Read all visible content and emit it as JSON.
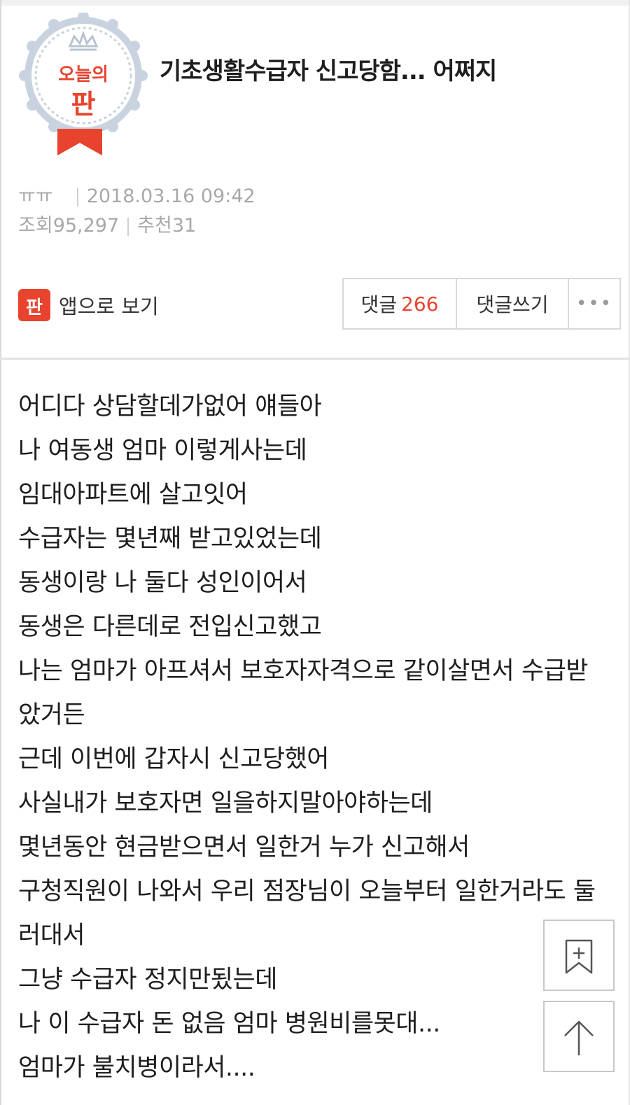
{
  "badge": {
    "line1": "오늘의",
    "line2": "판",
    "icon": "crown-badge-icon"
  },
  "post": {
    "title": "기초생활수급자 신고당함... 어쩌지",
    "author": "ㅠㅠ",
    "datetime": "2018.03.16 09:42",
    "views_label": "조회",
    "views": "95,297",
    "recommend_label": "추천",
    "recommend": "31"
  },
  "actions": {
    "app_icon_text": "판",
    "app_view": "앱으로 보기",
    "comments_label": "댓글",
    "comments_count": "266",
    "write_comment": "댓글쓰기",
    "more": "•••"
  },
  "body": {
    "lines": [
      "어디다 상담할데가없어 얘들아",
      "나 여동생 엄마 이렇게사는데",
      "임대아파트에 살고잇어",
      "수급자는 몇년째 받고있었는데",
      "동생이랑 나 둘다 성인이어서",
      "동생은 다른데로 전입신고했고",
      "나는 엄마가 아프셔서 보호자자격으로 같이살면서 수급받",
      "았거든",
      "근데 이번에 갑자시 신고당했어",
      "사실내가 보호자면 일을하지말아야하는데",
      "몇년동안 현금받으면서 일한거 누가 신고해서",
      "구청직원이 나와서 우리 점장님이 오늘부터 일한거라도 둘",
      "러대서",
      "그냥 수급자 정지만됬는데",
      "나 이 수급자 돈 없음 엄마 병원비를못대...",
      "엄마가 불치병이라서...."
    ]
  },
  "floating": {
    "bookmark_icon": "bookmark-add-icon",
    "top_icon": "arrow-up-icon"
  },
  "colors": {
    "accent": "#e8432e",
    "meta": "#a8a8a8",
    "border": "#d9d9d9"
  }
}
